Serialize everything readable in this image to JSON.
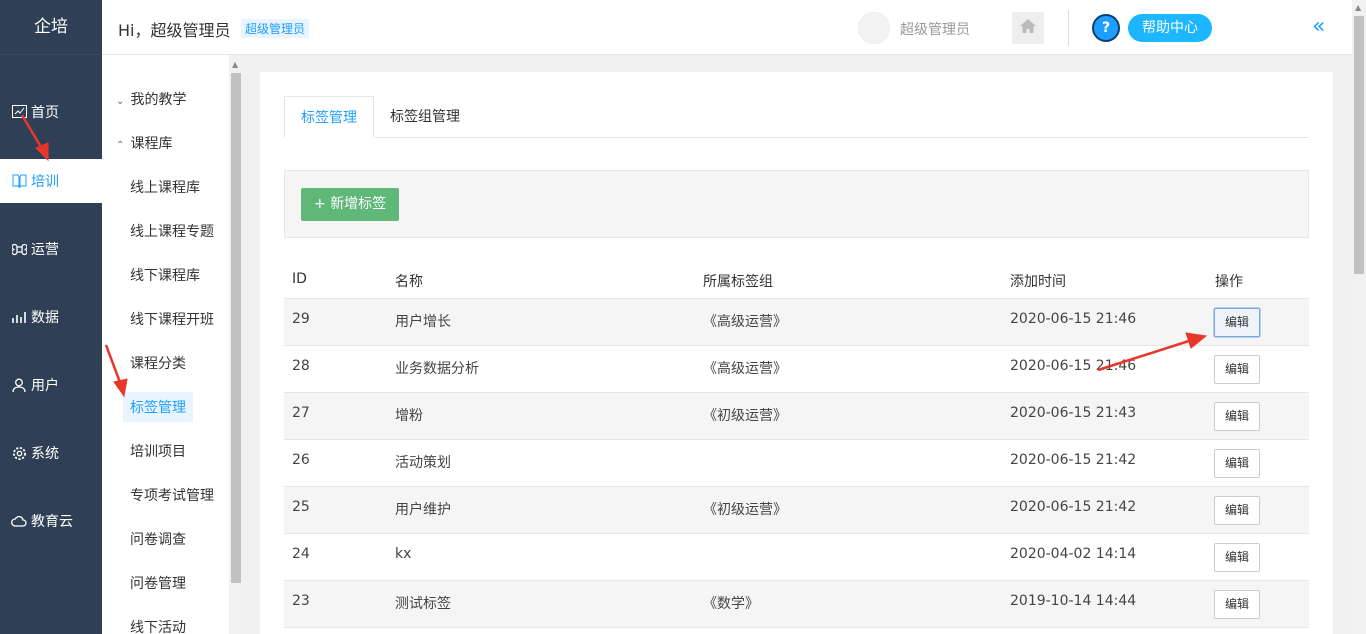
{
  "brand": "企培",
  "nav": [
    {
      "label": "首页",
      "icon": "chart-icon"
    },
    {
      "label": "培训",
      "icon": "book-icon",
      "active": true
    },
    {
      "label": "运营",
      "icon": "command-icon"
    },
    {
      "label": "数据",
      "icon": "bar-chart-icon"
    },
    {
      "label": "用户",
      "icon": "user-icon"
    },
    {
      "label": "系统",
      "icon": "gear-icon"
    },
    {
      "label": "教育云",
      "icon": "cloud-icon"
    }
  ],
  "subnav": {
    "group1": "我的教学",
    "group2": "课程库",
    "items": [
      "线上课程库",
      "线上课程专题",
      "线下课程库",
      "线下课程开班",
      "课程分类",
      "标签管理",
      "培训项目",
      "专项考试管理",
      "问卷调查",
      "问卷管理",
      "线下活动"
    ],
    "active": "标签管理"
  },
  "header": {
    "greeting": "Hi，超级管理员",
    "role_badge": "超级管理员",
    "user_name": "超级管理员",
    "help_label": "帮助中心",
    "help_q": "?",
    "collapse": "«"
  },
  "tabs": [
    "标签管理",
    "标签组管理"
  ],
  "add_button": "新增标签",
  "add_plus": "+",
  "table": {
    "headers": [
      "ID",
      "名称",
      "所属标签组",
      "添加时间",
      "操作"
    ],
    "edit_label": "编辑",
    "rows": [
      {
        "id": "29",
        "name": "用户增长",
        "group": "《高级运营》",
        "time": "2020-06-15 21:46"
      },
      {
        "id": "28",
        "name": "业务数据分析",
        "group": "《高级运营》",
        "time": "2020-06-15 21:46"
      },
      {
        "id": "27",
        "name": "增粉",
        "group": "《初级运营》",
        "time": "2020-06-15 21:43"
      },
      {
        "id": "26",
        "name": "活动策划",
        "group": "",
        "time": "2020-06-15 21:42"
      },
      {
        "id": "25",
        "name": "用户维护",
        "group": "《初级运营》",
        "time": "2020-06-15 21:42"
      },
      {
        "id": "24",
        "name": "kx",
        "group": "",
        "time": "2020-04-02 14:14"
      },
      {
        "id": "23",
        "name": "测试标签",
        "group": "《数学》",
        "time": "2019-10-14 14:44"
      }
    ]
  },
  "colors": {
    "sidebar": "#2f4056",
    "accent": "#1e9fff",
    "add_button": "#5fb878",
    "annotation_arrow": "#e8362b"
  }
}
